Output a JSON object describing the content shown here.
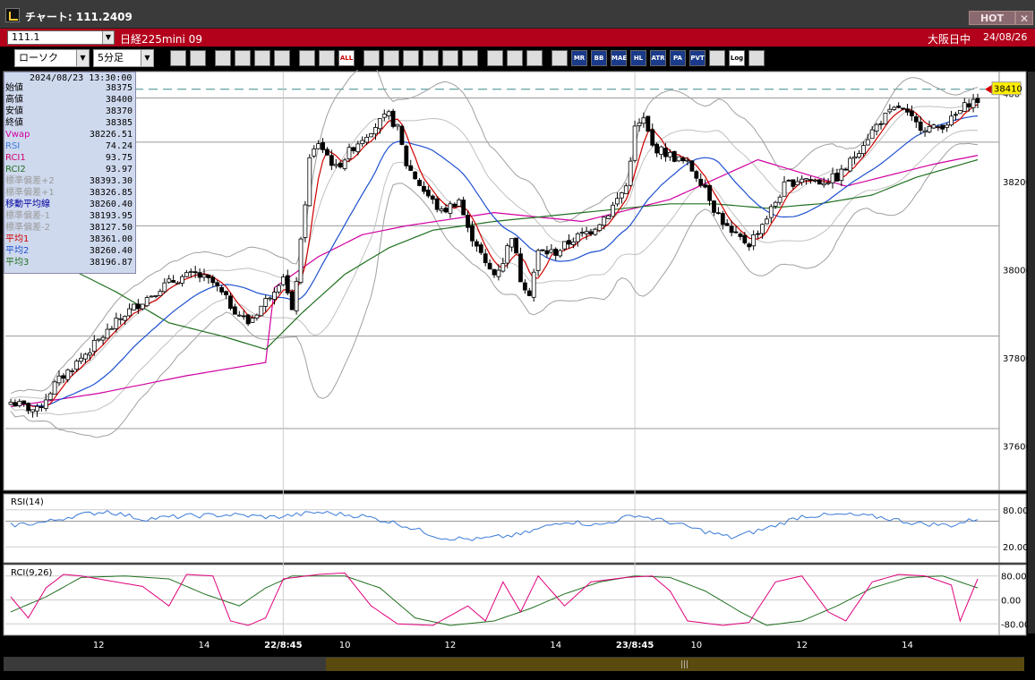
{
  "window": {
    "title": "チャート: 111.2409",
    "hot_label": "HOT",
    "close_glyph": "✕"
  },
  "symbol": {
    "code": "111.1",
    "name": "日経225mini 09",
    "market": "大阪日中",
    "date": "24/08/26"
  },
  "toolbar": {
    "chart_type": "ローソク",
    "interval": "5分足",
    "icons": [
      "zoom-icon",
      "crosshair-icon",
      "candle-sell-icon",
      "price-panel-icon",
      "buy-sell-icon",
      "lock-icon",
      "candle-style-icon",
      "candle-color-icon",
      "all-icon",
      "pencil-icon",
      "eraser-icon",
      "cursor-icon",
      "curve-icon",
      "document-icon",
      "trash-icon",
      "grid-icon",
      "wrench-icon",
      "palette-icon",
      "volume-profile-icon",
      "mr-icon",
      "bb-icon",
      "mae-icon",
      "hl-icon",
      "atr-icon",
      "para-icon",
      "pvt-icon",
      "window-icon",
      "log-icon",
      "export-icon"
    ],
    "icon_labels": [
      "",
      "",
      "",
      "",
      "",
      "",
      "",
      "",
      "ALL",
      "",
      "",
      "",
      "",
      "",
      "",
      "",
      "",
      "",
      "",
      "MR",
      "BB",
      "MAE",
      "HL",
      "ATR",
      "PA RA",
      "PVT",
      "",
      "Log",
      ""
    ]
  },
  "info": {
    "datetime": "2024/08/23  13:30:00",
    "rows": [
      {
        "label": "始値",
        "value": "38375",
        "color": "#000000"
      },
      {
        "label": "高値",
        "value": "38400",
        "color": "#000000"
      },
      {
        "label": "安値",
        "value": "38370",
        "color": "#000000"
      },
      {
        "label": "終値",
        "value": "38385",
        "color": "#000000"
      },
      {
        "label": "Vwap",
        "value": "38226.51",
        "color": "#d000a0"
      },
      {
        "label": "RSI",
        "value": "74.24",
        "color": "#3a7ad8"
      },
      {
        "label": "RCI1",
        "value": "93.75",
        "color": "#d0006a"
      },
      {
        "label": "RCI2",
        "value": "93.97",
        "color": "#207020"
      },
      {
        "label": "標準偏差+2",
        "value": "38393.30",
        "color": "#9a9a9a"
      },
      {
        "label": "標準偏差+1",
        "value": "38326.85",
        "color": "#9a9a9a"
      },
      {
        "label": "移動平均線",
        "value": "38260.40",
        "color": "#0000a0"
      },
      {
        "label": "標準偏差-1",
        "value": "38193.95",
        "color": "#9a9a9a"
      },
      {
        "label": "標準偏差-2",
        "value": "38127.50",
        "color": "#9a9a9a"
      },
      {
        "label": "平均1",
        "value": "38361.00",
        "color": "#d00000"
      },
      {
        "label": "平均2",
        "value": "38260.40",
        "color": "#1e50d0"
      },
      {
        "label": "平均3",
        "value": "38196.87",
        "color": "#207020"
      }
    ]
  },
  "chart_data": {
    "type": "candlestick",
    "price_axis": {
      "ylim": [
        37500,
        38450
      ],
      "ticks": [
        37600,
        37800,
        38000,
        38200,
        38400
      ],
      "tick_labels": [
        "37600",
        "37800",
        "38000",
        "38200",
        "400"
      ]
    },
    "last_price_label": "38410",
    "x_labels": [
      {
        "text": "12",
        "bar": 20
      },
      {
        "text": "14",
        "bar": 44
      },
      {
        "text": "22/8:45",
        "bar": 62
      },
      {
        "text": "10",
        "bar": 76
      },
      {
        "text": "12",
        "bar": 100
      },
      {
        "text": "14",
        "bar": 124
      },
      {
        "text": "23/8:45",
        "bar": 142
      },
      {
        "text": "10",
        "bar": 156
      },
      {
        "text": "12",
        "bar": 180
      },
      {
        "text": "14",
        "bar": 204
      }
    ],
    "close_anchors": [
      [
        0,
        37700
      ],
      [
        3,
        37690
      ],
      [
        6,
        37680
      ],
      [
        10,
        37740
      ],
      [
        14,
        37780
      ],
      [
        18,
        37820
      ],
      [
        22,
        37860
      ],
      [
        26,
        37900
      ],
      [
        30,
        37930
      ],
      [
        34,
        37960
      ],
      [
        38,
        37980
      ],
      [
        42,
        37990
      ],
      [
        46,
        37970
      ],
      [
        50,
        37920
      ],
      [
        54,
        37880
      ],
      [
        58,
        37930
      ],
      [
        62,
        37990
      ],
      [
        64,
        37900
      ],
      [
        66,
        38060
      ],
      [
        68,
        38250
      ],
      [
        70,
        38290
      ],
      [
        74,
        38230
      ],
      [
        78,
        38280
      ],
      [
        82,
        38320
      ],
      [
        86,
        38350
      ],
      [
        88,
        38320
      ],
      [
        90,
        38240
      ],
      [
        94,
        38180
      ],
      [
        98,
        38130
      ],
      [
        102,
        38160
      ],
      [
        104,
        38090
      ],
      [
        106,
        38060
      ],
      [
        108,
        38010
      ],
      [
        110,
        37990
      ],
      [
        112,
        38020
      ],
      [
        114,
        38080
      ],
      [
        116,
        37980
      ],
      [
        118,
        37950
      ],
      [
        120,
        38040
      ],
      [
        124,
        38040
      ],
      [
        128,
        38070
      ],
      [
        132,
        38090
      ],
      [
        136,
        38130
      ],
      [
        140,
        38190
      ],
      [
        142,
        38320
      ],
      [
        144,
        38340
      ],
      [
        146,
        38280
      ],
      [
        150,
        38260
      ],
      [
        154,
        38240
      ],
      [
        158,
        38190
      ],
      [
        160,
        38140
      ],
      [
        164,
        38080
      ],
      [
        168,
        38060
      ],
      [
        172,
        38120
      ],
      [
        176,
        38190
      ],
      [
        180,
        38210
      ],
      [
        184,
        38200
      ],
      [
        188,
        38210
      ],
      [
        190,
        38230
      ],
      [
        194,
        38290
      ],
      [
        198,
        38340
      ],
      [
        202,
        38370
      ],
      [
        206,
        38330
      ],
      [
        210,
        38320
      ],
      [
        214,
        38340
      ],
      [
        218,
        38380
      ],
      [
        220,
        38385
      ]
    ],
    "overlays": {
      "bb_mid_label": "移動平均線",
      "bb_label_plus2": "標準偏差+2",
      "bb_label_minus2": "標準偏差-2",
      "vwap_anchors": [
        [
          0,
          37690
        ],
        [
          20,
          37720
        ],
        [
          40,
          37760
        ],
        [
          58,
          37790
        ],
        [
          60,
          37960
        ],
        [
          70,
          38030
        ],
        [
          80,
          38080
        ],
        [
          90,
          38100
        ],
        [
          110,
          38130
        ],
        [
          130,
          38110
        ],
        [
          150,
          38160
        ],
        [
          170,
          38250
        ],
        [
          190,
          38190
        ],
        [
          210,
          38240
        ],
        [
          220,
          38260
        ]
      ],
      "ma3_anchors": [
        [
          0,
          38030
        ],
        [
          12,
          38010
        ],
        [
          24,
          37950
        ],
        [
          36,
          37880
        ],
        [
          48,
          37850
        ],
        [
          58,
          37820
        ],
        [
          66,
          37900
        ],
        [
          76,
          37990
        ],
        [
          86,
          38050
        ],
        [
          96,
          38090
        ],
        [
          110,
          38110
        ],
        [
          130,
          38130
        ],
        [
          150,
          38150
        ],
        [
          160,
          38150
        ],
        [
          172,
          38140
        ],
        [
          184,
          38150
        ],
        [
          196,
          38170
        ],
        [
          206,
          38210
        ],
        [
          220,
          38250
        ]
      ],
      "dashed_level": 38410,
      "hlines": [
        38390,
        38290,
        38100,
        37850,
        37640,
        37430
      ],
      "vline_bars": [
        62,
        142
      ]
    },
    "rsi": {
      "title": "RSI(14)",
      "ticks": [
        {
          "v": 80,
          "label": "80.00"
        },
        {
          "v": 20,
          "label": "20.00"
        }
      ],
      "ylim": [
        0,
        100
      ],
      "anchors": [
        [
          0,
          55
        ],
        [
          8,
          60
        ],
        [
          14,
          70
        ],
        [
          22,
          78
        ],
        [
          30,
          65
        ],
        [
          40,
          70
        ],
        [
          50,
          72
        ],
        [
          60,
          68
        ],
        [
          70,
          76
        ],
        [
          80,
          70
        ],
        [
          88,
          58
        ],
        [
          98,
          35
        ],
        [
          106,
          32
        ],
        [
          116,
          40
        ],
        [
          126,
          62
        ],
        [
          134,
          55
        ],
        [
          142,
          72
        ],
        [
          150,
          60
        ],
        [
          158,
          45
        ],
        [
          164,
          35
        ],
        [
          172,
          50
        ],
        [
          180,
          70
        ],
        [
          190,
          72
        ],
        [
          198,
          68
        ],
        [
          206,
          58
        ],
        [
          214,
          55
        ],
        [
          220,
          66
        ]
      ]
    },
    "rci": {
      "title": "RCI(9,26)",
      "ticks": [
        {
          "v": 80,
          "label": "80.00"
        },
        {
          "v": 0,
          "label": "0.00"
        },
        {
          "v": -80,
          "label": "-80.00"
        }
      ],
      "ylim": [
        -100,
        100
      ],
      "rci1_anchors": [
        [
          0,
          10
        ],
        [
          4,
          -60
        ],
        [
          8,
          40
        ],
        [
          12,
          85
        ],
        [
          16,
          80
        ],
        [
          24,
          60
        ],
        [
          30,
          45
        ],
        [
          36,
          -20
        ],
        [
          40,
          85
        ],
        [
          46,
          80
        ],
        [
          50,
          -70
        ],
        [
          54,
          -85
        ],
        [
          58,
          -60
        ],
        [
          62,
          70
        ],
        [
          70,
          85
        ],
        [
          76,
          90
        ],
        [
          82,
          -20
        ],
        [
          88,
          -80
        ],
        [
          96,
          -85
        ],
        [
          104,
          -20
        ],
        [
          108,
          -70
        ],
        [
          112,
          60
        ],
        [
          116,
          -40
        ],
        [
          120,
          80
        ],
        [
          126,
          -20
        ],
        [
          132,
          60
        ],
        [
          140,
          75
        ],
        [
          146,
          80
        ],
        [
          150,
          30
        ],
        [
          154,
          -70
        ],
        [
          162,
          -85
        ],
        [
          168,
          -75
        ],
        [
          174,
          60
        ],
        [
          180,
          80
        ],
        [
          186,
          -40
        ],
        [
          190,
          -70
        ],
        [
          196,
          60
        ],
        [
          202,
          85
        ],
        [
          208,
          80
        ],
        [
          214,
          50
        ],
        [
          216,
          -70
        ],
        [
          220,
          70
        ]
      ],
      "rci2_anchors": [
        [
          0,
          -40
        ],
        [
          8,
          10
        ],
        [
          16,
          75
        ],
        [
          26,
          80
        ],
        [
          36,
          70
        ],
        [
          44,
          20
        ],
        [
          52,
          -20
        ],
        [
          58,
          40
        ],
        [
          64,
          80
        ],
        [
          76,
          80
        ],
        [
          84,
          40
        ],
        [
          92,
          -60
        ],
        [
          100,
          -85
        ],
        [
          110,
          -70
        ],
        [
          118,
          -30
        ],
        [
          126,
          20
        ],
        [
          134,
          60
        ],
        [
          142,
          80
        ],
        [
          150,
          75
        ],
        [
          158,
          30
        ],
        [
          166,
          -40
        ],
        [
          172,
          -85
        ],
        [
          180,
          -70
        ],
        [
          188,
          -20
        ],
        [
          196,
          40
        ],
        [
          204,
          75
        ],
        [
          212,
          80
        ],
        [
          220,
          40
        ]
      ]
    },
    "bars_total": 221
  }
}
